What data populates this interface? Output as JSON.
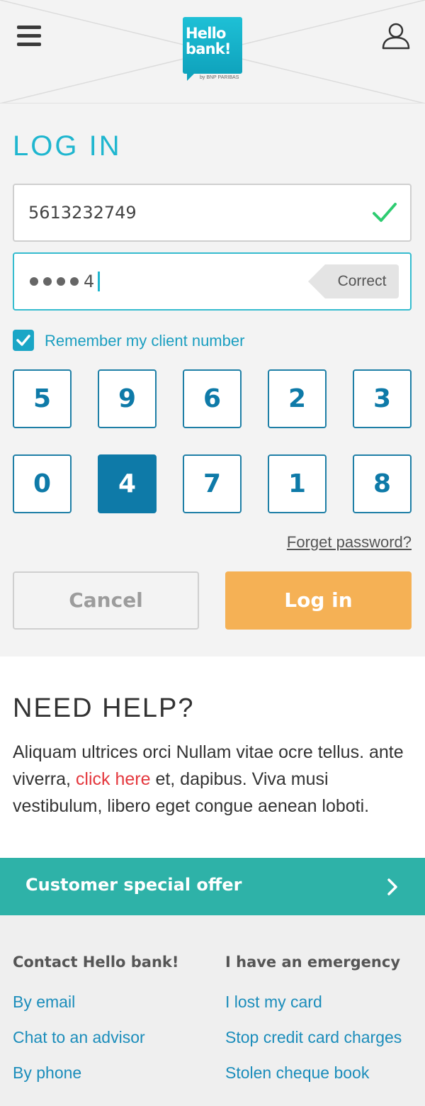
{
  "header": {
    "logo_line1": "Hello",
    "logo_line2": "bank!",
    "logo_sub": "by BNP PARIBAS"
  },
  "login": {
    "title": "LOG IN",
    "client_number": "5613232749",
    "password_last_char": "4",
    "password_masked_count": 4,
    "correct_label": "Correct",
    "remember_label": "Remember my client number",
    "remember_checked": true,
    "keypad": [
      [
        "5",
        "9",
        "6",
        "2",
        "3"
      ],
      [
        "0",
        "4",
        "7",
        "1",
        "8"
      ]
    ],
    "keypad_active": "4",
    "forgot_label": "Forget password?",
    "cancel_label": "Cancel",
    "login_label": "Log in"
  },
  "help": {
    "title": "NEED HELP?",
    "text_before": "Aliquam ultrices orci Nullam vitae ocre tellus. ante viverra, ",
    "link_text": "click here",
    "text_after": " et, dapibus. Viva musi vestibulum, libero eget congue aenean loboti."
  },
  "offer": {
    "label": "Customer special offer"
  },
  "footer": {
    "col1": {
      "heading": "Contact Hello bank!",
      "links": [
        "By email",
        "Chat to an advisor",
        "By phone"
      ]
    },
    "col2": {
      "heading": "I have an emergency",
      "links": [
        "I lost my card",
        "Stop credit card charges",
        "Stolen cheque book"
      ]
    }
  },
  "colors": {
    "brand_cyan": "#1fb6cf",
    "keypad_blue": "#0e7aa8",
    "login_orange": "#f5b155",
    "offer_teal": "#2eb2a8",
    "link_red": "#e4383e",
    "valid_green": "#2ecc71"
  },
  "icons": {
    "menu": "hamburger-icon",
    "user": "user-icon",
    "valid": "checkmark-icon",
    "remember": "checkbox-checked-icon",
    "offer": "chevron-right-icon"
  }
}
